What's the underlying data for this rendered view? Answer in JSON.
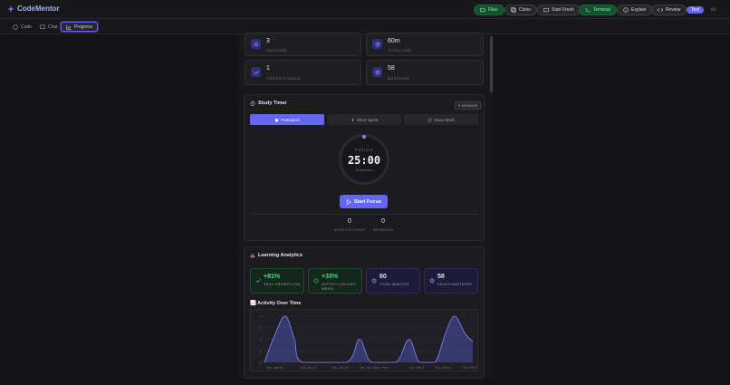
{
  "app": {
    "name": "CodeMentor"
  },
  "toolbar": {
    "files": "Files",
    "clone": "Clone",
    "start_fresh": "Start Fresh",
    "terminal": "Terminal",
    "explain": "Explain",
    "review": "Review",
    "text_toggle": "Text",
    "viz_toggle": "Viz"
  },
  "tabs": [
    {
      "label": "Code"
    },
    {
      "label": "Chat"
    },
    {
      "label": "Progress"
    }
  ],
  "stats_top": [
    {
      "value": "3",
      "label": "SESSIONS"
    },
    {
      "value": "60m",
      "label": "TOTAL TIME"
    },
    {
      "value": "1",
      "label": "TOPICS STUDIED"
    },
    {
      "value": "58",
      "label": "MASTERED"
    }
  ],
  "study_timer": {
    "title": "Study Timer",
    "sessions_badge": "0 sessions",
    "modes": [
      {
        "label": "Pomodoro",
        "active": true
      },
      {
        "label": "Short Sprint",
        "active": false
      },
      {
        "label": "Deep Work",
        "active": false
      }
    ],
    "focus_label": "FOCUS",
    "time": "25:00",
    "mode_label": "Pomodoro",
    "start_button": "Start Focus",
    "mins_focused_value": "0",
    "mins_focused_label": "MINS FOCUSED",
    "sessions_value": "0",
    "sessions_label": "SESSIONS"
  },
  "analytics": {
    "title": "Learning Analytics",
    "cards": [
      {
        "value": "+81%",
        "label": "SKILL GROWTH (7D)"
      },
      {
        "value": "+33%",
        "label": "ACTIVITY (VS LAST WEEK)"
      },
      {
        "value": "60",
        "label": "TOTAL MINUTES"
      },
      {
        "value": "58",
        "label": "SKILLS MASTERED"
      }
    ],
    "chart_title": "📈 Activity Over Time"
  },
  "colors": {
    "accent": "#6366f1",
    "green": "#4ade80",
    "background": "#131316"
  },
  "chart_data": {
    "type": "area",
    "x": [
      "Sun, Jan 26",
      "Tue, Jan 27",
      "Thu, Jan 29",
      "Sat, Jan 31",
      "Sun, Feb 1",
      "Tue, Feb 3",
      "Thu, Feb 5",
      "Sat, Feb 7"
    ],
    "y_ticks": [
      "0",
      "1",
      "2",
      "3",
      "4"
    ],
    "ylim": [
      0,
      4
    ],
    "points": [
      {
        "x": 0.0,
        "y": 0
      },
      {
        "x": 0.4,
        "y": 2.4
      },
      {
        "x": 0.8,
        "y": 4.0
      },
      {
        "x": 1.15,
        "y": 2.0
      },
      {
        "x": 1.45,
        "y": 0
      },
      {
        "x": 3.15,
        "y": 0
      },
      {
        "x": 3.65,
        "y": 2.0
      },
      {
        "x": 4.1,
        "y": 0
      },
      {
        "x": 5.05,
        "y": 0
      },
      {
        "x": 5.55,
        "y": 2.0
      },
      {
        "x": 5.95,
        "y": 0
      },
      {
        "x": 6.55,
        "y": 0
      },
      {
        "x": 6.95,
        "y": 2.5
      },
      {
        "x": 7.3,
        "y": 4.0
      },
      {
        "x": 7.7,
        "y": 2.5
      },
      {
        "x": 8.0,
        "y": 1.8
      }
    ]
  }
}
